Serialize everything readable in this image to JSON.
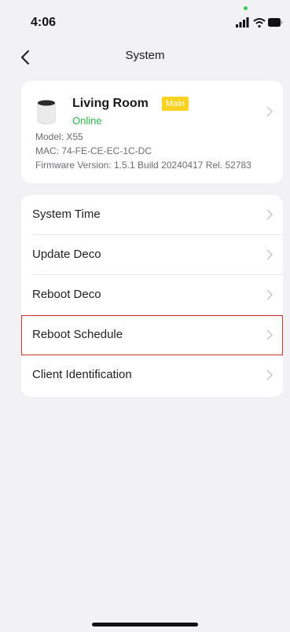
{
  "status_bar": {
    "time": "4:06",
    "icons": [
      "signal-icon",
      "wifi-icon",
      "battery-icon"
    ]
  },
  "nav": {
    "title": "System",
    "back_icon": "chevron-left-icon"
  },
  "device": {
    "name": "Living Room",
    "badge": "Main",
    "status": "Online",
    "model": "Model: X55",
    "mac": "MAC: 74-FE-CE-EC-1C-DC",
    "firmware": "Firmware Version: 1.5.1 Build 20240417 Rel. 52783",
    "icon": "deco-device-icon",
    "colors": {
      "badge": "#ffd21f",
      "online": "#2bb24c"
    }
  },
  "menu": {
    "items": [
      {
        "label": "System Time"
      },
      {
        "label": "Update Deco"
      },
      {
        "label": "Reboot Deco"
      },
      {
        "label": "Reboot Schedule"
      },
      {
        "label": "Client Identification"
      }
    ],
    "highlight_color": "#d0312d"
  }
}
